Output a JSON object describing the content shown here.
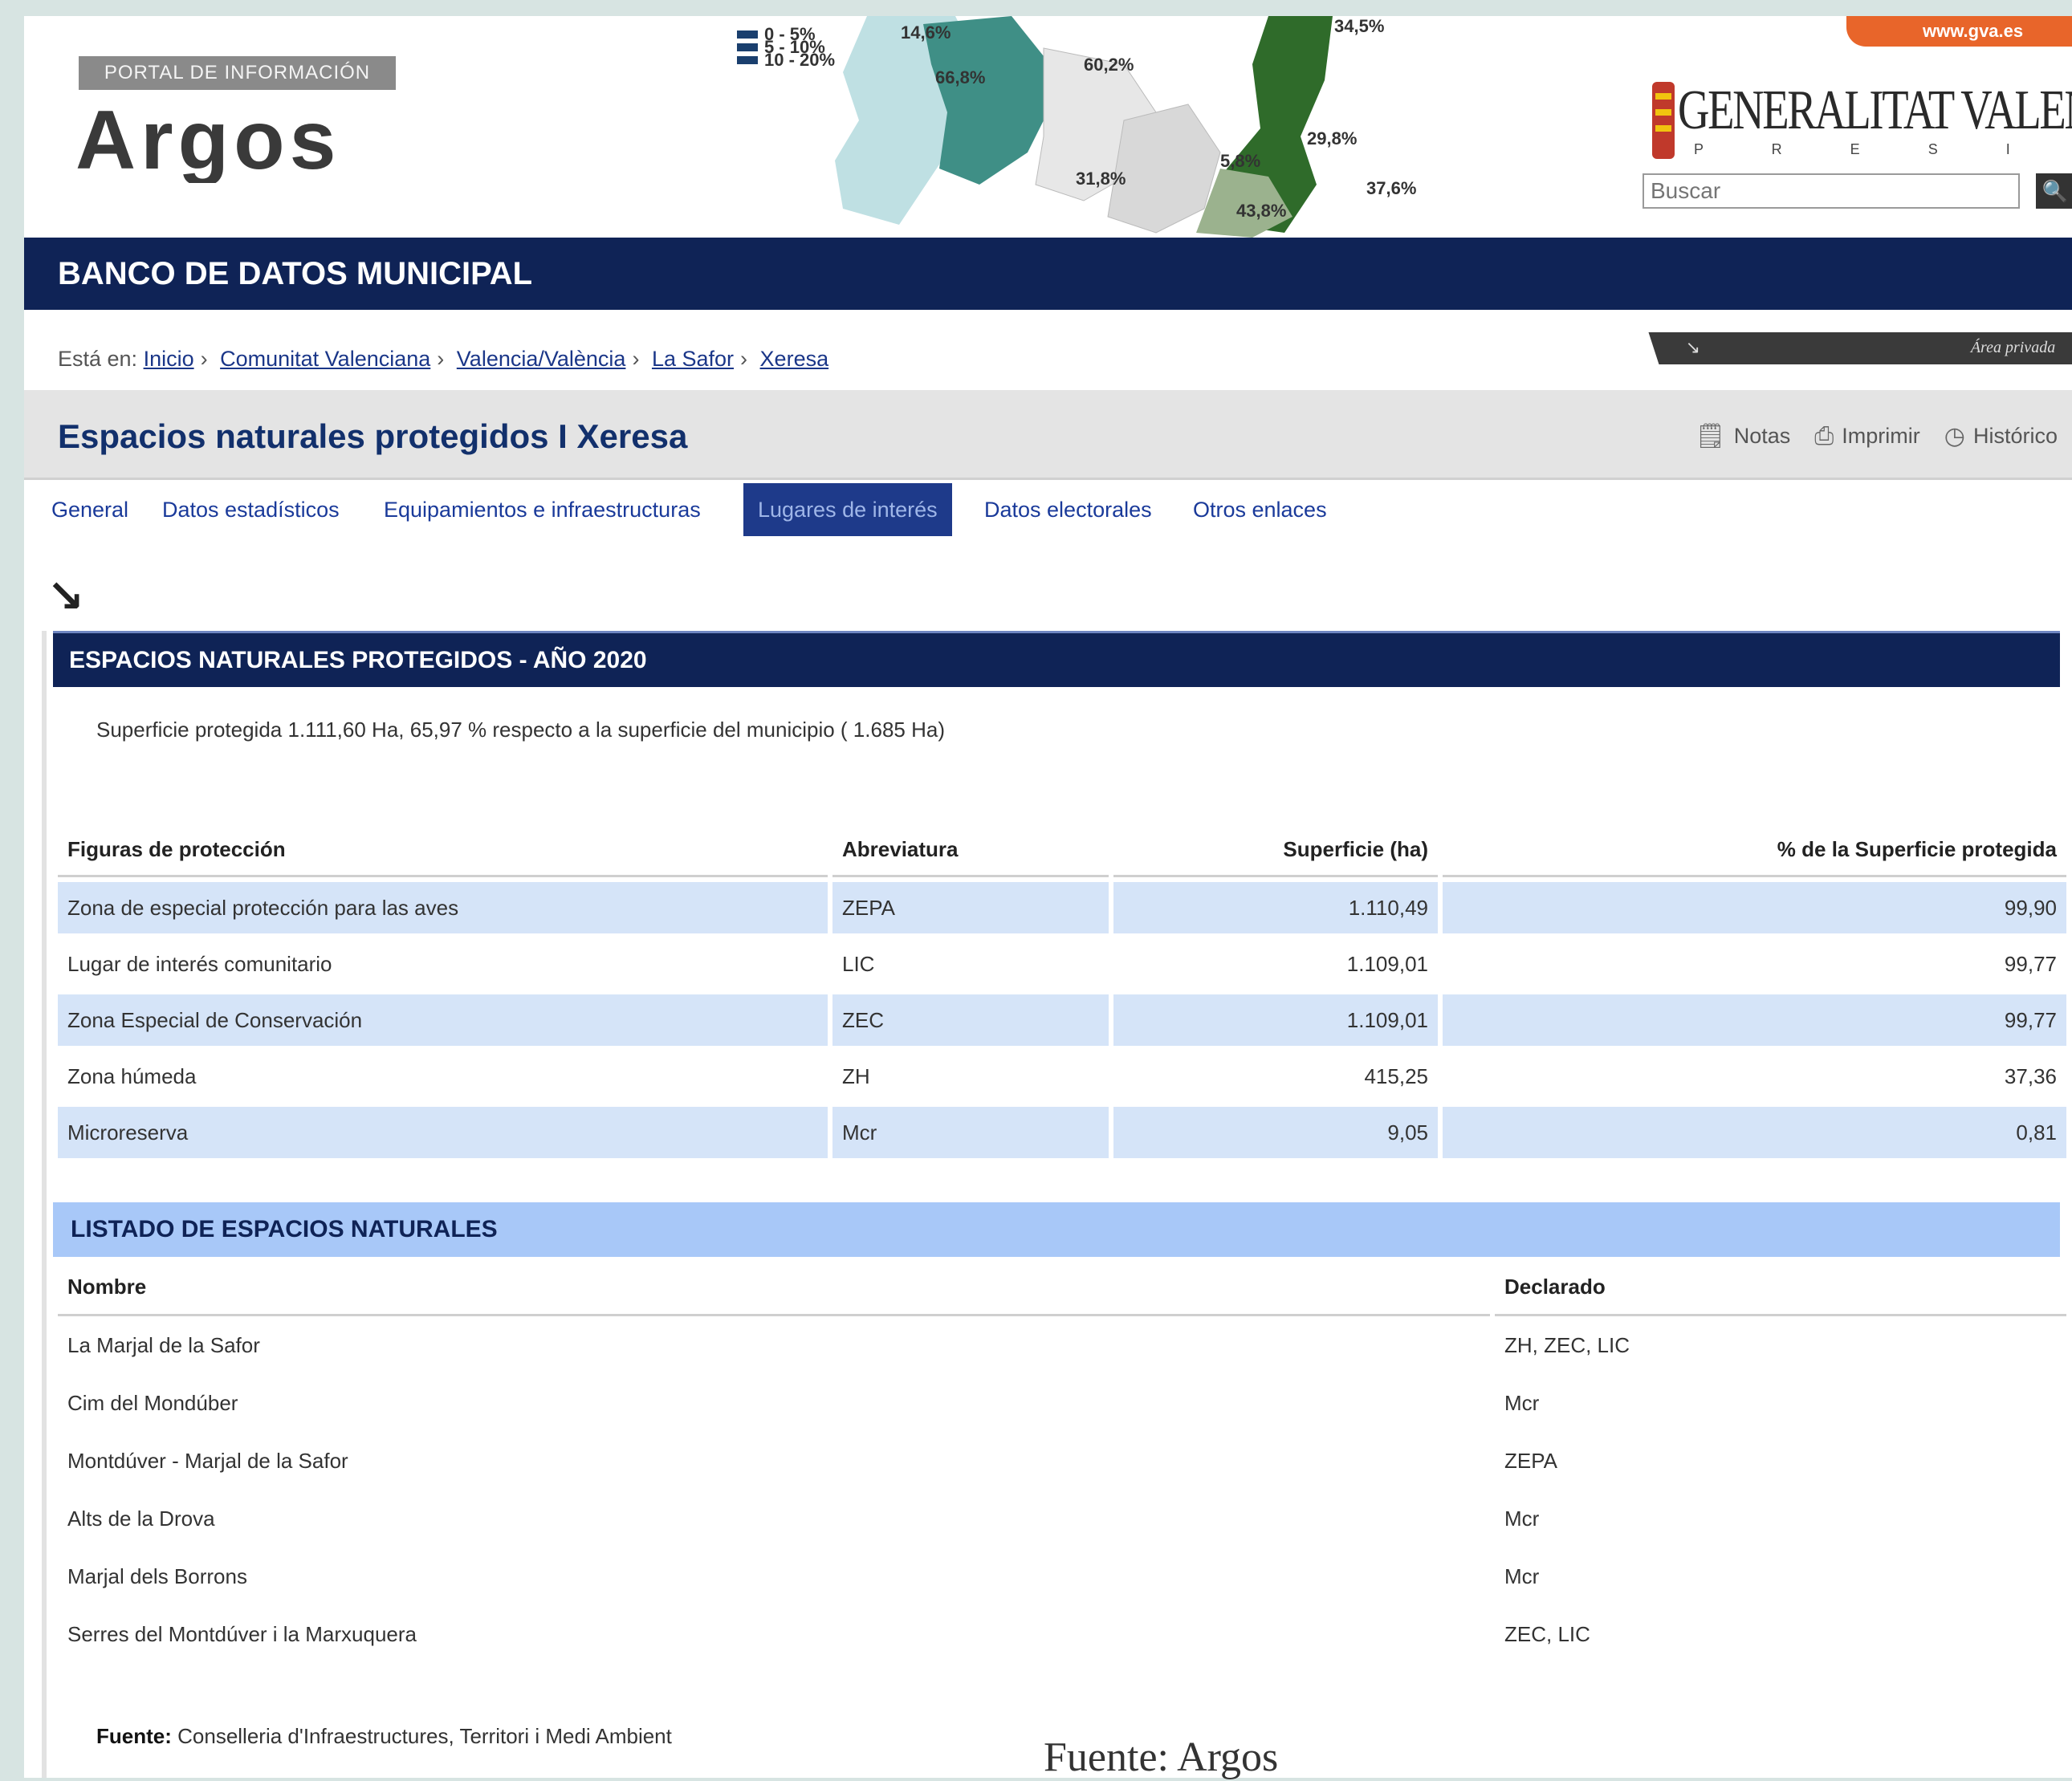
{
  "header": {
    "portal_badge": "PORTAL DE INFORMACIÓN",
    "logo_text": "Argos",
    "gva_link": "www.gva.es",
    "gv_name": "GENERALITAT VALENCIANA",
    "gv_sub": "P R E S I D E N C I A",
    "search": {
      "placeholder": "Buscar",
      "button_icon": "search-icon"
    },
    "map_labels": [
      "14,6%",
      "66,8%",
      "60,2%",
      "31,8%",
      "5,8%",
      "43,8%",
      "29,8%",
      "34,5%",
      "37,6%"
    ],
    "legend": [
      "0 - 5%",
      "5 - 10%",
      "10 - 20%"
    ]
  },
  "banner": {
    "title": "BANCO DE DATOS MUNICIPAL"
  },
  "breadcrumb": {
    "prefix": "Está en:",
    "items": [
      "Inicio",
      "Comunitat Valenciana",
      "Valencia/València",
      "La Safor",
      "Xeresa"
    ],
    "private_area": "Área privada"
  },
  "page": {
    "title": "Espacios naturales protegidos I Xeresa",
    "actions": [
      {
        "label": "Notas",
        "icon": "notes-icon"
      },
      {
        "label": "Imprimir",
        "icon": "print-icon"
      },
      {
        "label": "Histórico",
        "icon": "history-icon"
      }
    ]
  },
  "tabs": [
    "General",
    "Datos estadísticos",
    "Equipamientos e infraestructuras",
    "Lugares de interés",
    "Datos electorales",
    "Otros enlaces"
  ],
  "active_tab": "Lugares de interés",
  "section1": {
    "title": "ESPACIOS NATURALES PROTEGIDOS - AÑO 2020",
    "summary": "Superficie protegida 1.111,60 Ha, 65,97 % respecto a la superficie del municipio ( 1.685 Ha)",
    "columns": [
      "Figuras de protección",
      "Abreviatura",
      "Superficie (ha)",
      "% de la Superficie protegida"
    ],
    "rows": [
      [
        "Zona de especial protección para las aves",
        "ZEPA",
        "1.110,49",
        "99,90"
      ],
      [
        "Lugar de interés comunitario",
        "LIC",
        "1.109,01",
        "99,77"
      ],
      [
        "Zona Especial de Conservación",
        "ZEC",
        "1.109,01",
        "99,77"
      ],
      [
        "Zona húmeda",
        "ZH",
        "415,25",
        "37,36"
      ],
      [
        "Microreserva",
        "Mcr",
        "9,05",
        "0,81"
      ]
    ]
  },
  "section2": {
    "title": "LISTADO DE ESPACIOS NATURALES",
    "columns": [
      "Nombre",
      "Declarado"
    ],
    "rows": [
      [
        "La Marjal de la Safor",
        "ZH, ZEC, LIC"
      ],
      [
        "Cim del Mondúber",
        "Mcr"
      ],
      [
        "Montdúver - Marjal de la Safor",
        "ZEPA"
      ],
      [
        "Alts de la Drova",
        "Mcr"
      ],
      [
        "Marjal dels Borrons",
        "Mcr"
      ],
      [
        "Serres del Montdúver i la Marxuquera",
        "ZEC, LIC"
      ]
    ]
  },
  "source": {
    "label": "Fuente:",
    "text": "Conselleria d'Infraestructures, Territori i Medi Ambient"
  },
  "caption": "Fuente: Argos",
  "colors": {
    "navy": "#0f2356",
    "tab_active": "#1e3a8a",
    "row_shade": "#d5e4f8",
    "section2_head": "#a8c8f8",
    "gva_orange": "#e8652a"
  }
}
